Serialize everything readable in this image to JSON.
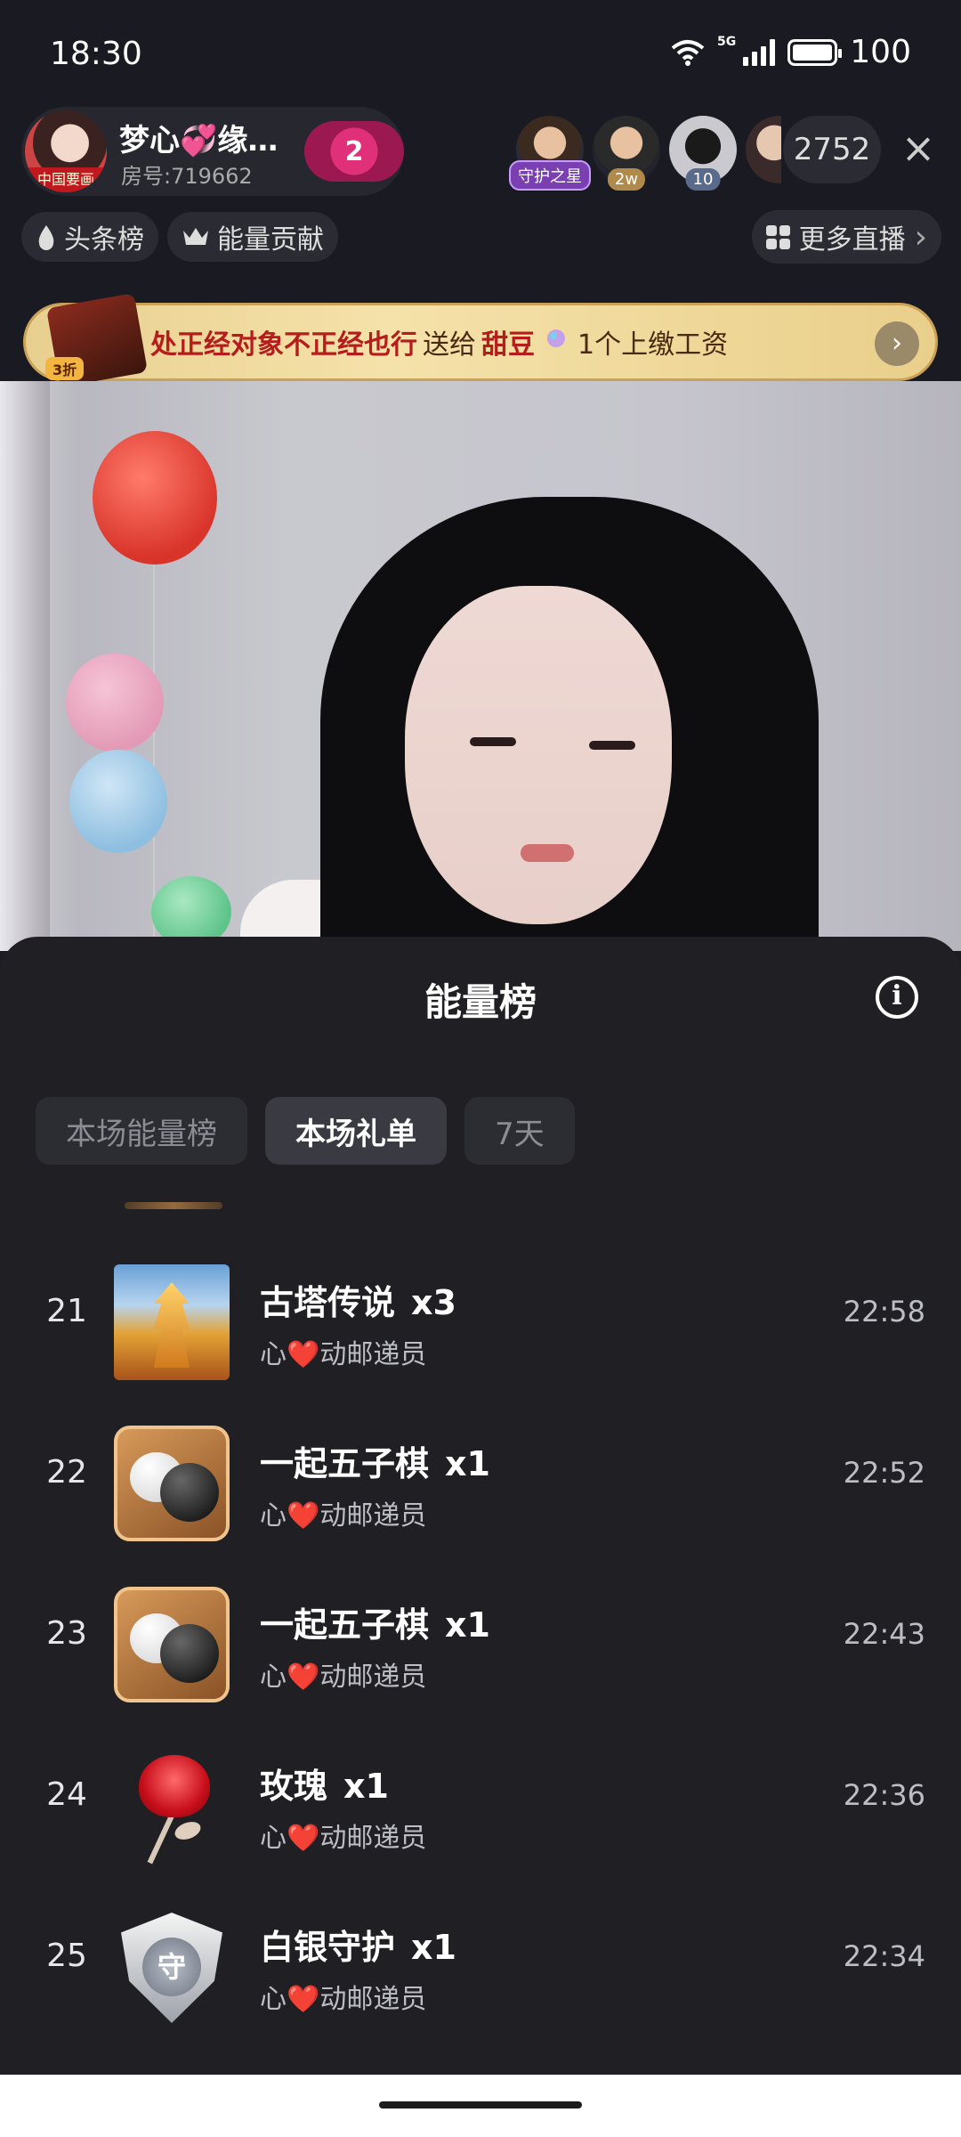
{
  "status_bar": {
    "time": "18:30",
    "network": "5G",
    "battery": "100"
  },
  "anchor": {
    "name": "梦心💞缘…",
    "room": "房号:719662",
    "avatar_tag": "中国要画",
    "badge_count": "2"
  },
  "viewers": {
    "badges": [
      "守护之星",
      "2w",
      "10"
    ],
    "count": "2752",
    "close_icon": "×"
  },
  "rank_row": {
    "headline": "头条榜",
    "energy_contribution": "能量贡献",
    "more_live": "更多直播",
    "more_chevron": "›"
  },
  "banner": {
    "text_prefix": "处正经对象不正经也行",
    "verb": "送给",
    "target": "甜豆",
    "gift_text": "1个上缴工资",
    "discount": "3折",
    "go_icon": "›"
  },
  "sheet": {
    "title": "能量榜",
    "info_icon": "i",
    "tabs": [
      "本场能量榜",
      "本场礼单",
      "7天"
    ],
    "active_tab": 1
  },
  "gift_list": [
    {
      "rank": "21",
      "gift": "古塔传说",
      "qty": "x3",
      "sender": "心❤️动邮递员",
      "time": "22:58",
      "icon": "tower-gift-icon"
    },
    {
      "rank": "22",
      "gift": "一起五子棋",
      "qty": "x1",
      "sender": "心❤️动邮递员",
      "time": "22:52",
      "icon": "gomoku-gift-icon"
    },
    {
      "rank": "23",
      "gift": "一起五子棋",
      "qty": "x1",
      "sender": "心❤️动邮递员",
      "time": "22:43",
      "icon": "gomoku-gift-icon"
    },
    {
      "rank": "24",
      "gift": "玫瑰",
      "qty": "x1",
      "sender": "心❤️动邮递员",
      "time": "22:36",
      "icon": "rose-gift-icon"
    },
    {
      "rank": "25",
      "gift": "白银守护",
      "qty": "x1",
      "sender": "心❤️动邮递员",
      "time": "22:34",
      "icon": "silver-guard-gift-icon"
    }
  ],
  "guard_glyph": "守",
  "colors": {
    "sheet_bg": "#1f1f24",
    "accent_banner": "#f5e2aa",
    "highlight": "#b71c1c"
  }
}
